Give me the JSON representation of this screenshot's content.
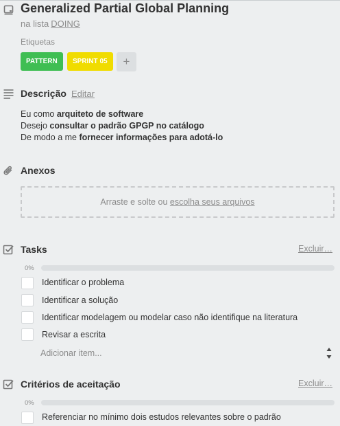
{
  "card": {
    "title": "Generalized Partial Global Planning",
    "list_prefix": "na lista",
    "list_name": "DOING"
  },
  "labels": {
    "heading": "Etiquetas",
    "items": [
      {
        "text": "PATTERN",
        "color": "#3fbe53"
      },
      {
        "text": "SPRINT 05",
        "color": "#f0dc00"
      }
    ],
    "add": "+"
  },
  "description": {
    "heading": "Descrição",
    "edit": "Editar",
    "lines": [
      {
        "pre": "Eu como ",
        "bold": "arquiteto de software"
      },
      {
        "pre": "Desejo ",
        "bold": "consultar o padrão GPGP no catálogo"
      },
      {
        "pre": "De modo a me ",
        "bold": "fornecer informações para adotá-lo"
      }
    ]
  },
  "attachments": {
    "heading": "Anexos",
    "drop_text": "Arraste e solte ou",
    "drop_link": "escolha seus arquivos"
  },
  "checklists": [
    {
      "heading": "Tasks",
      "delete": "Excluir…",
      "progress_label": "0%",
      "progress": 0,
      "items": [
        "Identificar o problema",
        "Identificar a solução",
        "Identificar modelagem ou modelar caso não identifique na literatura",
        "Revisar a escrita"
      ],
      "add_placeholder": "Adicionar item..."
    },
    {
      "heading": "Critérios de aceitação",
      "delete": "Excluir…",
      "progress_label": "0%",
      "progress": 0,
      "items": [
        "Referenciar no mínimo dois estudos relevantes sobre o padrão"
      ]
    }
  ],
  "icons": {
    "card": "card-icon",
    "description": "description-lines-icon",
    "attachment": "paperclip-icon",
    "checklist": "checkbox-icon"
  }
}
